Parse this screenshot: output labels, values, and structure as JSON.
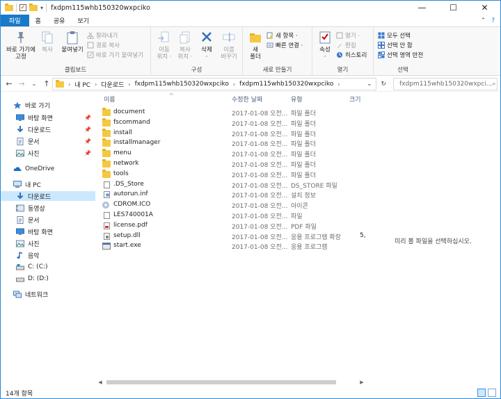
{
  "window": {
    "title": "fxdpm115whb150320wxpciko",
    "minimize": "—",
    "maximize": "☐",
    "close": "✕"
  },
  "ribbon_tabs": {
    "file": "파일",
    "home": "홈",
    "share": "공유",
    "view": "보기"
  },
  "ribbon": {
    "clipboard": {
      "label": "클립보드",
      "pin": "바로 가기에\n고정",
      "copy": "복사",
      "paste": "붙여넣기",
      "cut": "잘라내기",
      "copy_path": "경로 복사",
      "paste_shortcut": "바로 가기 붙여넣기"
    },
    "organize": {
      "label": "구성",
      "move_to": "이동\n위치 ·",
      "copy_to": "복사\n위치 ·",
      "delete": "삭제\n·",
      "rename": "이름\n바꾸기"
    },
    "new": {
      "label": "새로 만들기",
      "new_folder": "새\n폴더",
      "new_item": "새 항목 ·",
      "easy_access": "빠른 연결 ·"
    },
    "open": {
      "label": "열기",
      "properties": "속성\n·",
      "open": "열기 ·",
      "edit": "편집",
      "history": "히스토리"
    },
    "select": {
      "label": "선택",
      "select_all": "모두 선택",
      "select_none": "선택 안 함",
      "invert": "선택 영역 반전"
    }
  },
  "address": {
    "back": "←",
    "forward": "→",
    "recent": "⌄",
    "up": "↑",
    "crumbs": [
      "내 PC",
      "다운로드",
      "fxdpm115whb150320wxpciko",
      "fxdpm115whb150320wxpciko"
    ],
    "dropdown": "⌄",
    "refresh": "↻",
    "search_placeholder": "fxdpm115whb150320wxpci...",
    "search_icon": "⌕"
  },
  "nav": {
    "quick_access": "바로 가기",
    "desktop": "바탕 화면",
    "downloads": "다운로드",
    "documents": "문서",
    "pictures": "사진",
    "onedrive": "OneDrive",
    "this_pc": "내 PC",
    "pc_downloads": "다운로드",
    "videos": "동영상",
    "pc_documents": "문서",
    "pc_desktop": "바탕 화면",
    "pc_pictures": "사진",
    "music": "음악",
    "drive_c": "C: (C:)",
    "drive_d": "D: (D:)",
    "network": "네트워크"
  },
  "columns": {
    "name": "이름",
    "date": "수정한 날짜",
    "type": "유형",
    "size": "크기",
    "sort_arrow": "^"
  },
  "files": [
    {
      "name": "document",
      "date": "2017-01-08 오전...",
      "type": "파일 폴더",
      "size": "",
      "icon": "folder"
    },
    {
      "name": "fscommand",
      "date": "2017-01-08 오전...",
      "type": "파일 폴더",
      "size": "",
      "icon": "folder"
    },
    {
      "name": "install",
      "date": "2017-01-08 오전...",
      "type": "파일 폴더",
      "size": "",
      "icon": "folder"
    },
    {
      "name": "installmanager",
      "date": "2017-01-08 오전...",
      "type": "파일 폴더",
      "size": "",
      "icon": "folder"
    },
    {
      "name": "menu",
      "date": "2017-01-08 오전...",
      "type": "파일 폴더",
      "size": "",
      "icon": "folder"
    },
    {
      "name": "network",
      "date": "2017-01-08 오전...",
      "type": "파일 폴더",
      "size": "",
      "icon": "folder"
    },
    {
      "name": "tools",
      "date": "2017-01-08 오전...",
      "type": "파일 폴더",
      "size": "",
      "icon": "folder"
    },
    {
      "name": ".DS_Store",
      "date": "2017-01-08 오전...",
      "type": "DS_STORE 파일",
      "size": "",
      "icon": "doc"
    },
    {
      "name": "autorun.inf",
      "date": "2017-01-08 오전...",
      "type": "설치 정보",
      "size": "",
      "icon": "cfg"
    },
    {
      "name": "CDROM.ICO",
      "date": "2017-01-08 오전...",
      "type": "아이콘",
      "size": "",
      "icon": "cd"
    },
    {
      "name": "LES740001A",
      "date": "2017-01-08 오전...",
      "type": "파일",
      "size": "",
      "icon": "doc"
    },
    {
      "name": "license.pdf",
      "date": "2017-01-08 오전...",
      "type": "PDF 파일",
      "size": "",
      "icon": "pdf"
    },
    {
      "name": "setup.dll",
      "date": "2017-01-08 오전...",
      "type": "응용 프로그램 확장",
      "size": "5,",
      "icon": "dll"
    },
    {
      "name": "start.exe",
      "date": "2017-01-08 오전...",
      "type": "응용 프로그램",
      "size": "",
      "icon": "exe"
    }
  ],
  "preview": {
    "message": "미리 볼 파일을 선택하십시오."
  },
  "status": {
    "item_count": "14개 항목"
  },
  "colors": {
    "accent": "#1979ca",
    "selection": "#cce8ff",
    "folder": "#f5c842"
  }
}
